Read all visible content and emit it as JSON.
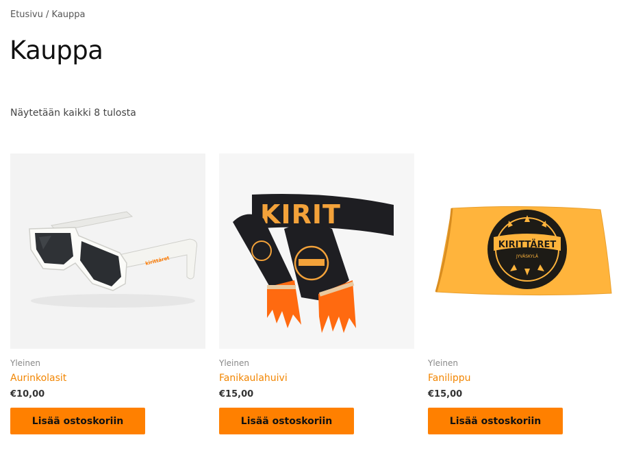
{
  "breadcrumb": {
    "home": "Etusivu",
    "separator": " / ",
    "current": "Kauppa"
  },
  "page_title": "Kauppa",
  "result_count": "Näytetään kaikki 8 tulosta",
  "accent_color": "#ff8000",
  "products": [
    {
      "category": "Yleinen",
      "name": "Aurinkolasit",
      "price": "€10,00",
      "button": "Lisää ostoskoriin"
    },
    {
      "category": "Yleinen",
      "name": "Fanikaulahuivi",
      "price": "€15,00",
      "button": "Lisää ostoskoriin",
      "scarf_text": "KIRIT"
    },
    {
      "category": "Yleinen",
      "name": "Fanilippu",
      "price": "€15,00",
      "button": "Lisää ostoskoriin",
      "flag_text": "KIRITTÄRET",
      "flag_subtext": "JYVÄSKYLÄ"
    }
  ]
}
